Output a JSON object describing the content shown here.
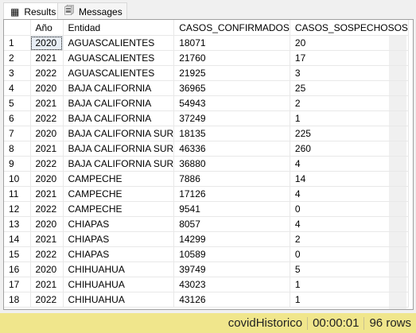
{
  "tabs": {
    "results": "Results",
    "messages": "Messages"
  },
  "columns": [
    "",
    "Año",
    "Entidad",
    "CASOS_CONFIRMADOS",
    "CASOS_SOSPECHOSOS"
  ],
  "rows": [
    [
      "1",
      "2020",
      "AGUASCALIENTES",
      "18071",
      "20"
    ],
    [
      "2",
      "2021",
      "AGUASCALIENTES",
      "21760",
      "17"
    ],
    [
      "3",
      "2022",
      "AGUASCALIENTES",
      "21925",
      "3"
    ],
    [
      "4",
      "2020",
      "BAJA CALIFORNIA",
      "36965",
      "25"
    ],
    [
      "5",
      "2021",
      "BAJA CALIFORNIA",
      "54943",
      "2"
    ],
    [
      "6",
      "2022",
      "BAJA CALIFORNIA",
      "37249",
      "1"
    ],
    [
      "7",
      "2020",
      "BAJA CALIFORNIA SUR",
      "18135",
      "225"
    ],
    [
      "8",
      "2021",
      "BAJA CALIFORNIA SUR",
      "46336",
      "260"
    ],
    [
      "9",
      "2022",
      "BAJA CALIFORNIA SUR",
      "36880",
      "4"
    ],
    [
      "10",
      "2020",
      "CAMPECHE",
      "7886",
      "14"
    ],
    [
      "11",
      "2021",
      "CAMPECHE",
      "17126",
      "4"
    ],
    [
      "12",
      "2022",
      "CAMPECHE",
      "9541",
      "0"
    ],
    [
      "13",
      "2020",
      "CHIAPAS",
      "8057",
      "4"
    ],
    [
      "14",
      "2021",
      "CHIAPAS",
      "14299",
      "2"
    ],
    [
      "15",
      "2022",
      "CHIAPAS",
      "10589",
      "0"
    ],
    [
      "16",
      "2020",
      "CHIHUAHUA",
      "39749",
      "5"
    ],
    [
      "17",
      "2021",
      "CHIHUAHUA",
      "43023",
      "1"
    ],
    [
      "18",
      "2022",
      "CHIHUAHUA",
      "43126",
      "1"
    ]
  ],
  "status": {
    "database": "covidHistorico",
    "elapsed": "00:00:01",
    "rows": "96 rows"
  }
}
